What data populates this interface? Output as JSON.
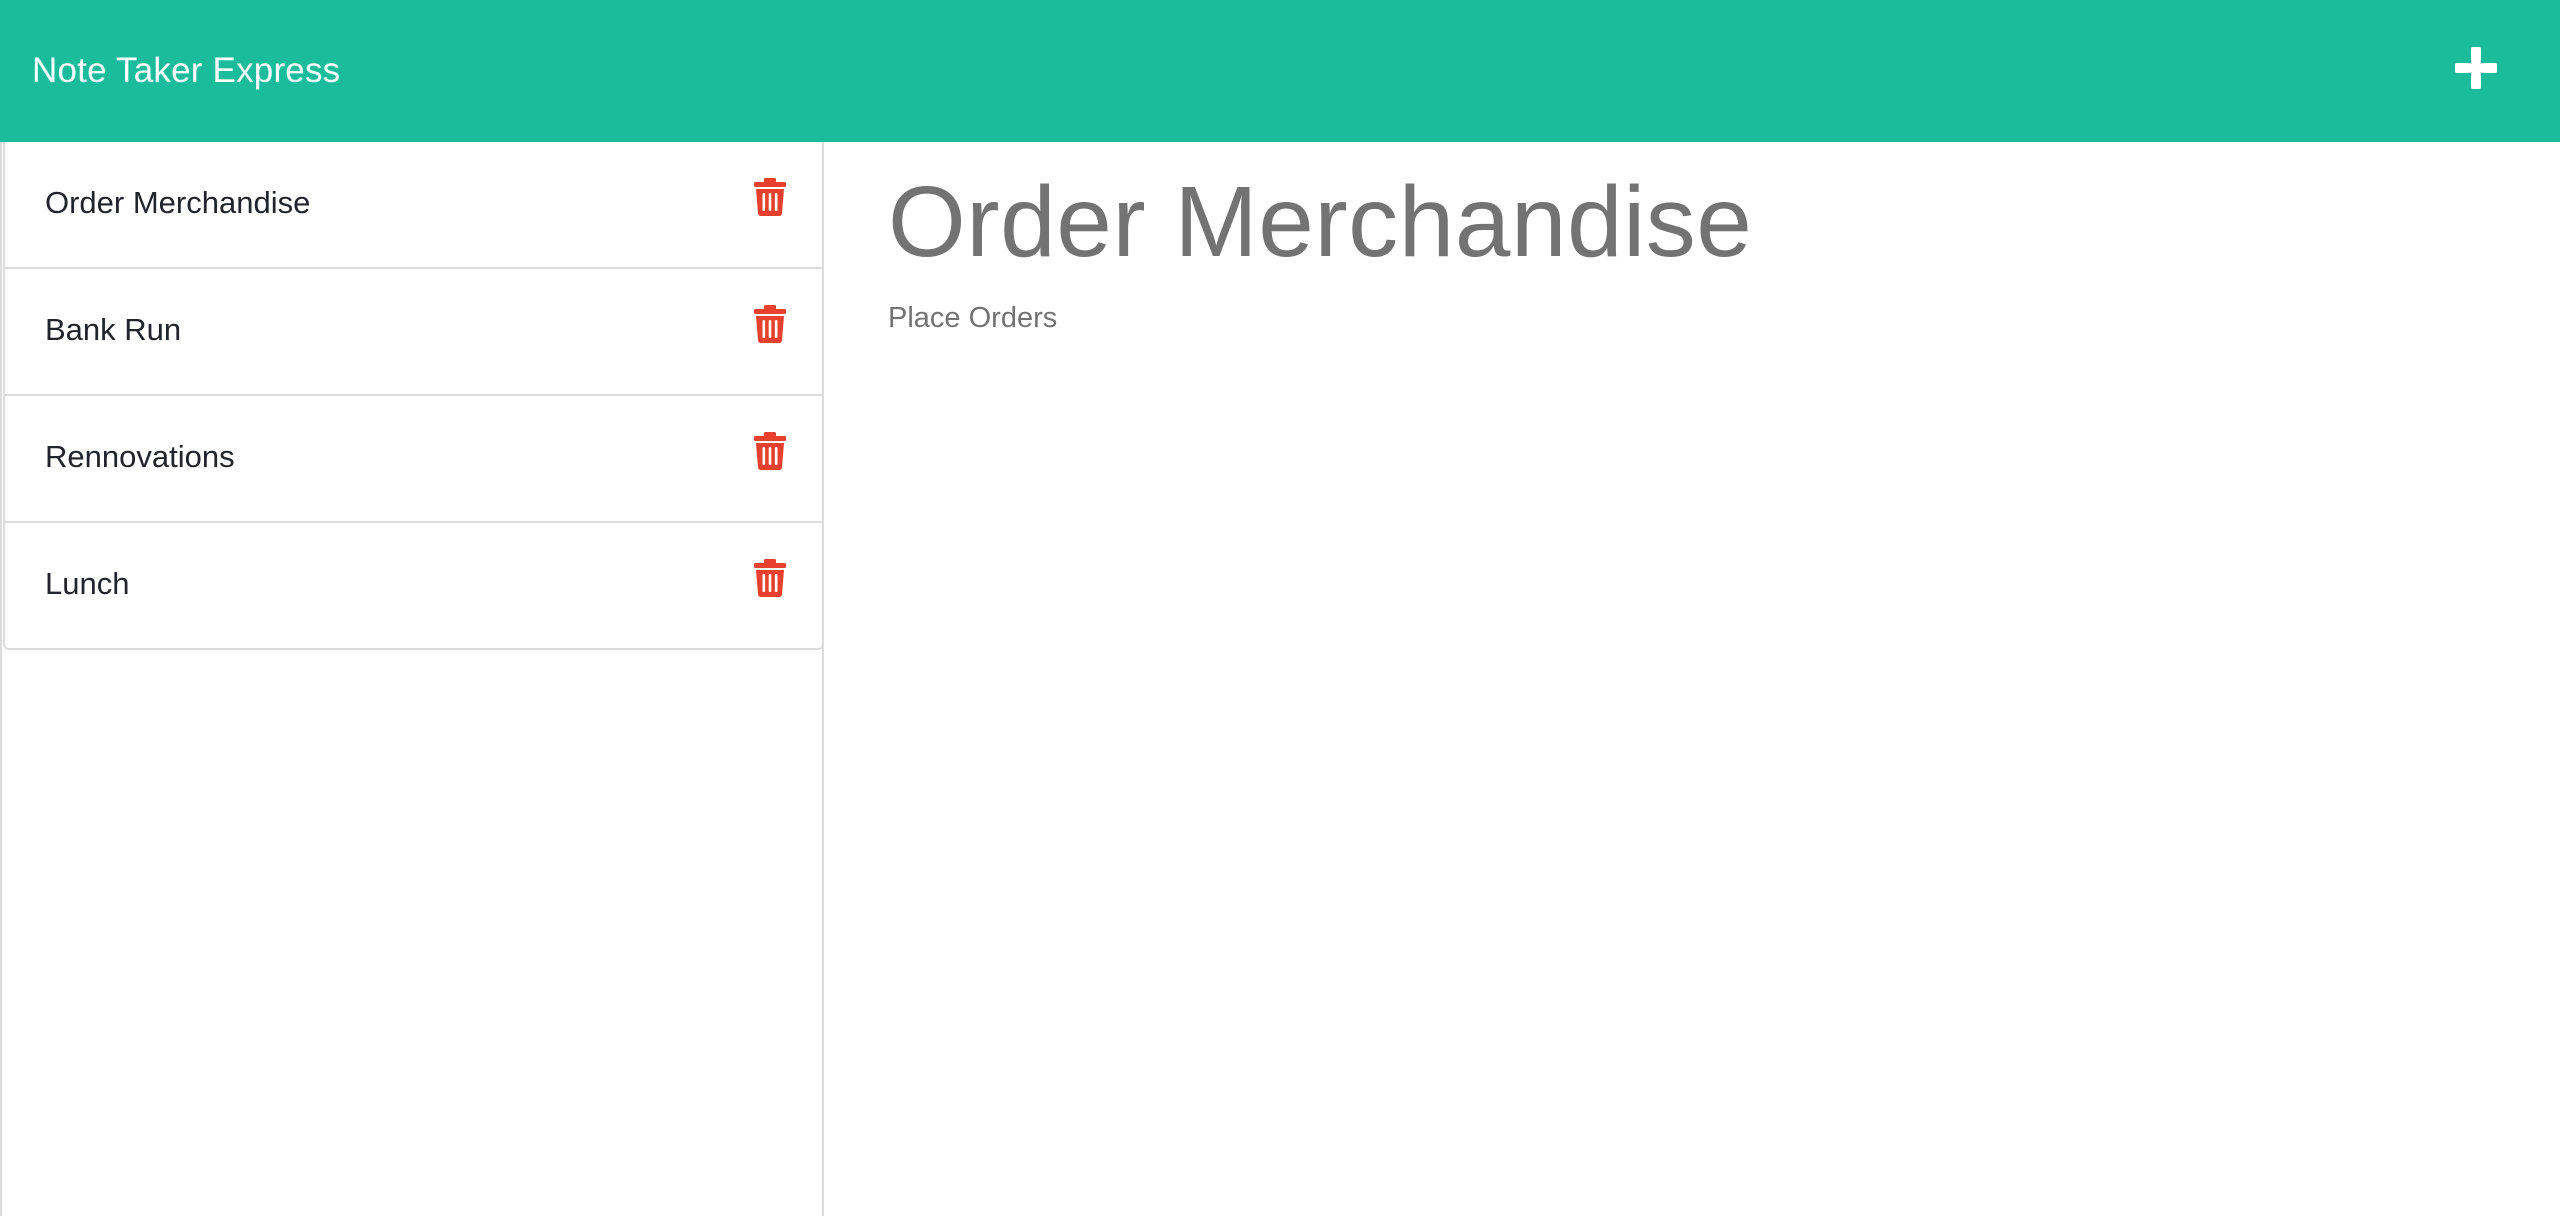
{
  "app": {
    "title": "Note Taker Express",
    "accent_color": "#1bbc9b",
    "delete_color": "#e8402f"
  },
  "toolbar": {
    "new_note_icon": "plus-icon"
  },
  "notes": [
    {
      "title": "Order Merchandise",
      "icon": "trash-icon"
    },
    {
      "title": "Bank Run",
      "icon": "trash-icon"
    },
    {
      "title": "Rennovations",
      "icon": "trash-icon"
    },
    {
      "title": "Lunch",
      "icon": "trash-icon"
    }
  ],
  "active_note": {
    "title": "Order Merchandise",
    "text": "Place Orders"
  }
}
